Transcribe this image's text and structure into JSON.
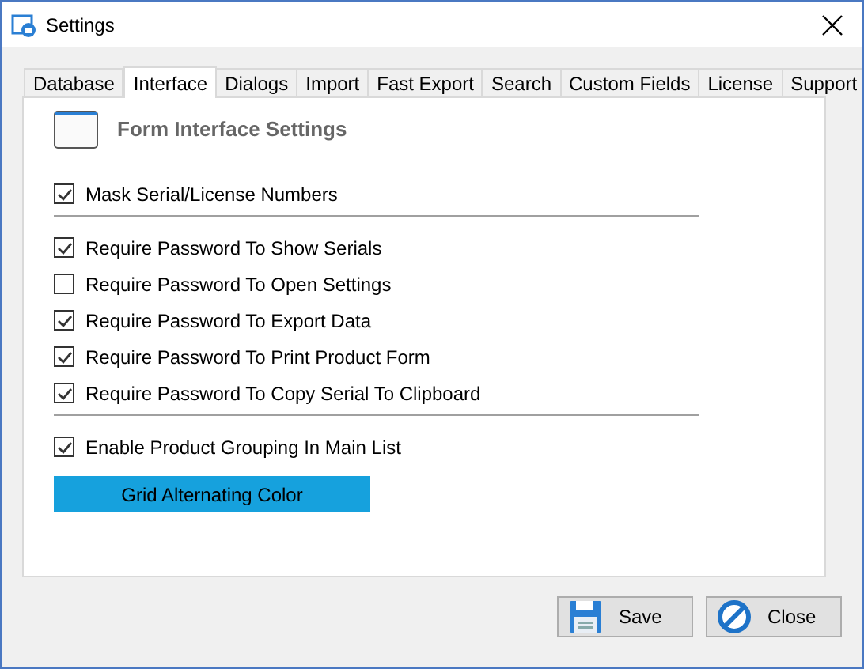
{
  "window": {
    "title": "Settings"
  },
  "tabs": [
    {
      "label": "Database",
      "selected": false
    },
    {
      "label": "Interface",
      "selected": true
    },
    {
      "label": "Dialogs",
      "selected": false
    },
    {
      "label": "Import",
      "selected": false
    },
    {
      "label": "Fast Export",
      "selected": false
    },
    {
      "label": "Search",
      "selected": false
    },
    {
      "label": "Custom Fields",
      "selected": false
    },
    {
      "label": "License",
      "selected": false
    },
    {
      "label": "Support",
      "selected": false
    }
  ],
  "section_title": "Form Interface Settings",
  "option_groups": [
    [
      {
        "label": "Mask Serial/License Numbers",
        "checked": true
      }
    ],
    [
      {
        "label": "Require Password To Show Serials",
        "checked": true
      },
      {
        "label": "Require Password To Open Settings",
        "checked": false
      },
      {
        "label": "Require Password To Export Data",
        "checked": true
      },
      {
        "label": "Require Password To Print Product Form",
        "checked": true
      },
      {
        "label": "Require Password To Copy Serial To Clipboard",
        "checked": true
      }
    ],
    [
      {
        "label": "Enable Product Grouping In Main List",
        "checked": true
      }
    ]
  ],
  "color_button": "Grid Alternating Color",
  "buttons": [
    {
      "label": "Save",
      "kind": "save"
    },
    {
      "label": "Close",
      "kind": "close"
    }
  ]
}
